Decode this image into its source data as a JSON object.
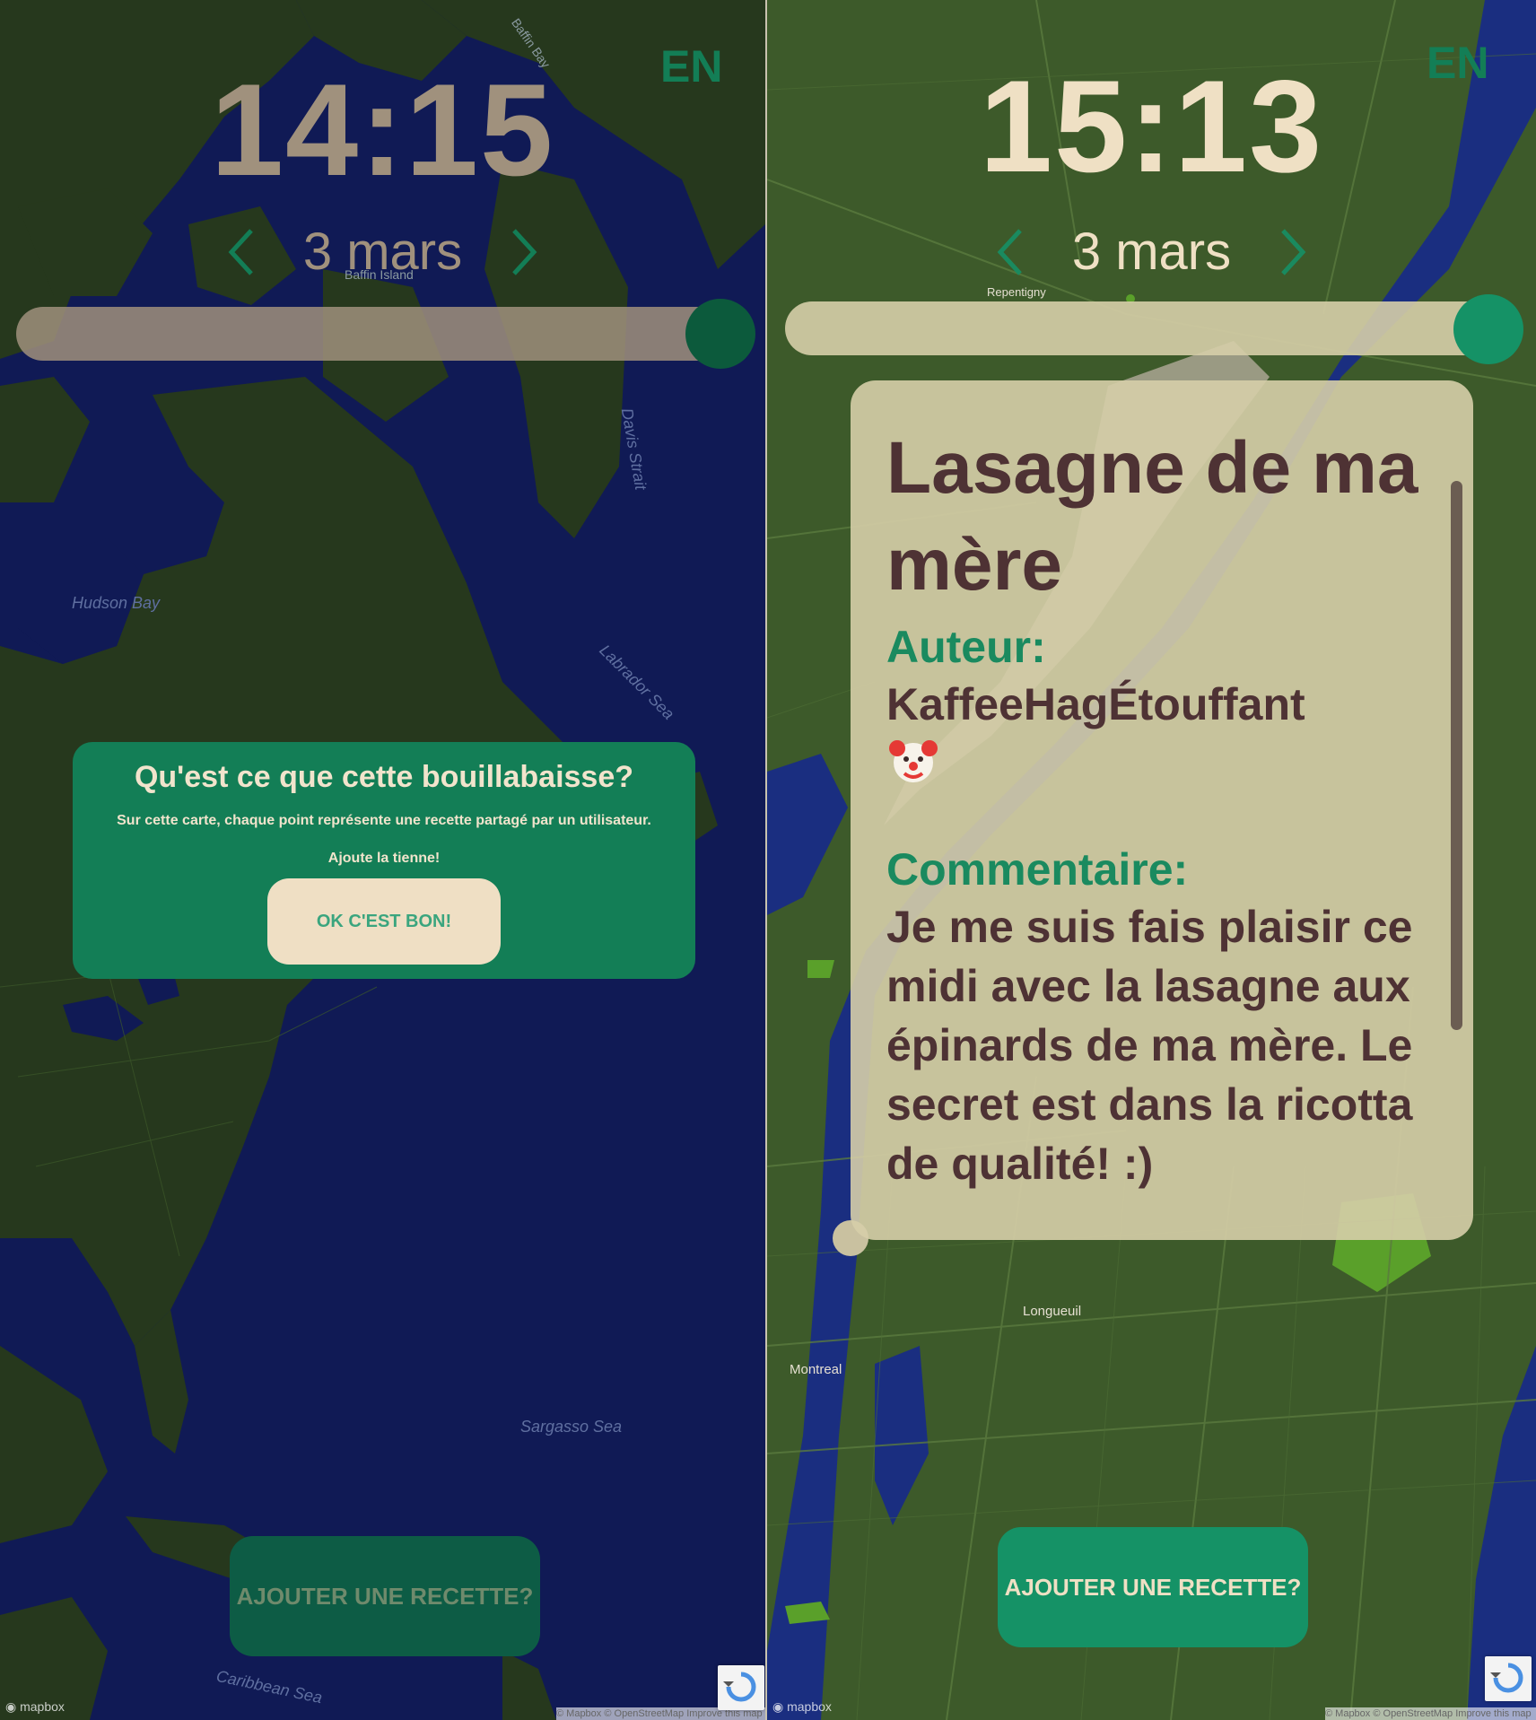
{
  "left_screen": {
    "time": "14:15",
    "language_toggle": "EN",
    "date": "3 mars",
    "map_labels": [
      "Baffin Bay",
      "Baffin Island",
      "Hudson Bay",
      "Davis Strait",
      "Labrador Sea",
      "Sargasso Sea",
      "Caribbean Sea"
    ],
    "intro_modal": {
      "title": "Qu'est ce que cette bouillabaisse?",
      "text": "Sur cette carte, chaque point représente une recette partagé par un utilisateur.",
      "cta_text": "Ajoute la tienne!",
      "ok_button": "OK C'EST BON!"
    },
    "add_recipe_button": "AJOUTER UNE RECETTE?"
  },
  "right_screen": {
    "time": "15:13",
    "language_toggle": "EN",
    "date": "3 mars",
    "map_labels": [
      "Montreal",
      "Longueuil",
      "Repentigny"
    ],
    "recipe_card": {
      "title": "Lasagne de ma mère",
      "author_label": "Auteur:",
      "author_name": "KaffeeHagÉtouffant",
      "author_emoji_icon": "clown-face-icon",
      "comment_label": "Commentaire:",
      "comment": "Je me suis fais plaisir ce midi avec la lasagne aux épinards de ma mère. Le secret est dans la ricotta de qualité! :)"
    },
    "add_recipe_button": "AJOUTER UNE RECETTE?"
  },
  "colors": {
    "ocean": "#101a55",
    "land": "#26381d",
    "right_land": "#3d5a2a",
    "accent_green": "#137e56",
    "cream": "#efdfc4",
    "clock_left": "#a0917d",
    "clock_right": "#efe0c4",
    "card_text": "#4e3234"
  }
}
